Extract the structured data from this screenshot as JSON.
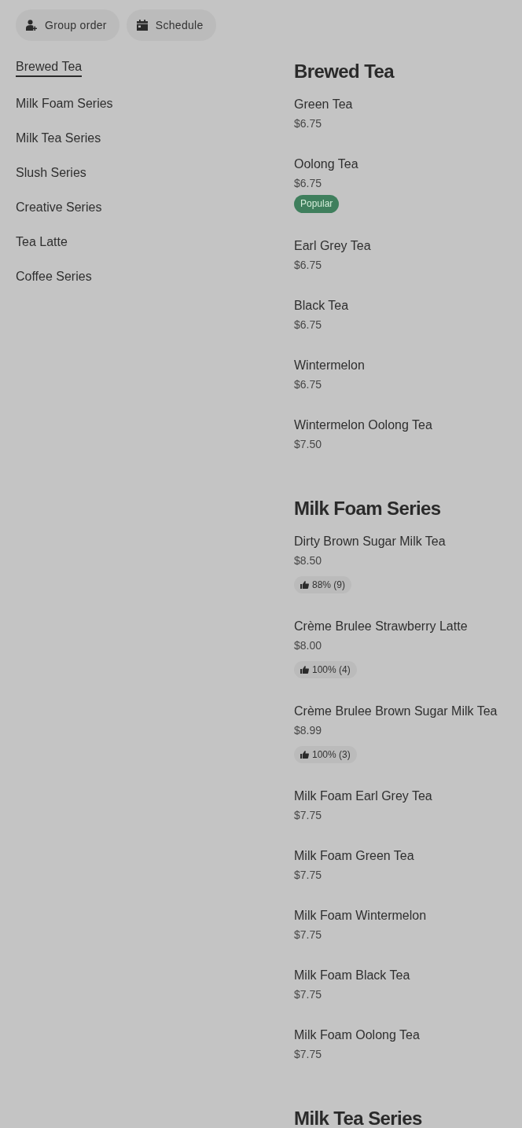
{
  "toolbar": {
    "buttons": [
      {
        "kind": "group",
        "label": "Group order"
      },
      {
        "kind": "schedule",
        "label": "Schedule"
      }
    ]
  },
  "categories": [
    {
      "label": "Brewed Tea",
      "selected": true
    },
    {
      "label": "Milk Foam Series",
      "selected": false
    },
    {
      "label": "Milk Tea Series",
      "selected": false
    },
    {
      "label": "Slush Series",
      "selected": false
    },
    {
      "label": "Creative Series",
      "selected": false
    },
    {
      "label": "Tea Latte",
      "selected": false
    },
    {
      "label": "Coffee Series",
      "selected": false
    }
  ],
  "sections": [
    {
      "title": "Brewed Tea",
      "items": [
        {
          "name": "Green Tea",
          "price": "$6.75"
        },
        {
          "name": "Oolong Tea",
          "price": "$6.75",
          "badge": "Popular"
        },
        {
          "name": "Earl Grey Tea",
          "price": "$6.75"
        },
        {
          "name": "Black Tea",
          "price": "$6.75"
        },
        {
          "name": "Wintermelon",
          "price": "$6.75"
        },
        {
          "name": "Wintermelon Oolong Tea",
          "price": "$7.50"
        }
      ]
    },
    {
      "title": "Milk Foam Series",
      "items": [
        {
          "name": "Dirty Brown Sugar Milk Tea",
          "price": "$8.50",
          "rating": "88% (9)"
        },
        {
          "name": "Crème Brulee Strawberry Latte",
          "price": "$8.00",
          "rating": "100% (4)"
        },
        {
          "name": "Crème Brulee Brown Sugar Milk Tea",
          "price": "$8.99",
          "rating": "100% (3)"
        },
        {
          "name": "Milk Foam Earl Grey Tea",
          "price": "$7.75"
        },
        {
          "name": "Milk Foam Green Tea",
          "price": "$7.75"
        },
        {
          "name": "Milk Foam Wintermelon",
          "price": "$7.75"
        },
        {
          "name": "Milk Foam Black Tea",
          "price": "$7.75"
        },
        {
          "name": "Milk Foam Oolong Tea",
          "price": "$7.75"
        }
      ]
    },
    {
      "title": "Milk Tea Series"
    }
  ]
}
